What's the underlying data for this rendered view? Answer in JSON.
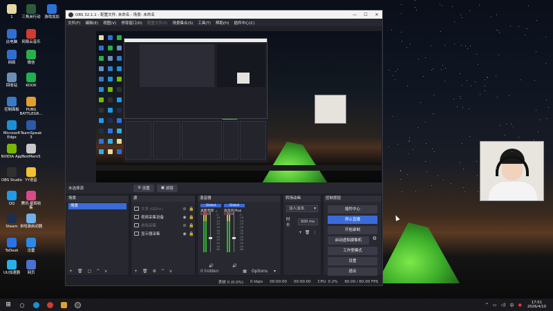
{
  "desktop": {
    "icons": [
      {
        "label": "1",
        "color": "#e8d9a0"
      },
      {
        "label": "三角洲行动",
        "color": "#2d5b3a"
      },
      {
        "label": "游戏加加",
        "color": "#2a72d8"
      },
      {
        "label": "此电脑",
        "color": "#2f6fd1"
      },
      {
        "label": "网易云音乐",
        "color": "#d33a31"
      },
      {
        "label": "网络",
        "color": "#2f6fd1"
      },
      {
        "label": "微信",
        "color": "#2aae4a"
      },
      {
        "label": "回收站",
        "color": "#6a8fb8"
      },
      {
        "label": "KOOK",
        "color": "#1fb14e"
      },
      {
        "label": "控制面板",
        "color": "#3a78c8"
      },
      {
        "label": "PUBG BATTLEGR...",
        "color": "#e0a030"
      },
      {
        "label": "Microsoft Edge",
        "color": "#1d8fd8"
      },
      {
        "label": "TeamSpeak 3",
        "color": "#2c5aa8"
      },
      {
        "label": "NVIDIA App",
        "color": "#76b900"
      },
      {
        "label": "TestMem5",
        "color": "#c8c8c8"
      },
      {
        "label": "OBS Studio",
        "color": "#303030"
      },
      {
        "label": "YY语音",
        "color": "#f2c230"
      },
      {
        "label": "QQ",
        "color": "#1e9ae8"
      },
      {
        "label": "腾讯·星辉收集",
        "color": "#d84a8a"
      },
      {
        "label": "Steam",
        "color": "#1c2f4f"
      },
      {
        "label": "米哈游启动器",
        "color": "#6fb0e8"
      },
      {
        "label": "ToDesk",
        "color": "#2a72e8"
      },
      {
        "label": "迅雷",
        "color": "#2a8ae8"
      },
      {
        "label": "UU加速器",
        "color": "#2ab0e8"
      },
      {
        "label": "网页",
        "color": "#4a70d0"
      }
    ]
  },
  "obs": {
    "title": "OBS 32.1.1 - 配置文件: 未命名 - 场景: 未命名",
    "menu": [
      "文件(F)",
      "编辑(E)",
      "视图(V)",
      "停靠窗口(D)",
      "配置文件(P)",
      "场景集合(S)",
      "工具(T)",
      "帮助(H)",
      "插件中心(C)"
    ],
    "menu_dim": [
      false,
      false,
      false,
      false,
      true,
      false,
      false,
      false,
      false
    ],
    "scene_bar": {
      "no_selection": "未选择源",
      "properties": "设置",
      "filters": "滤镜"
    },
    "scenes": {
      "header": "场景",
      "items": [
        "场景"
      ]
    },
    "sources": {
      "header": "源",
      "items": [
        {
          "label": "文本 (GDI+)",
          "dim": true
        },
        {
          "label": "视频采集设备",
          "dim": false
        },
        {
          "label": "游戏采集",
          "dim": true
        },
        {
          "label": "显示器采集",
          "dim": false
        }
      ]
    },
    "mixer": {
      "header": "混音器",
      "channels": [
        {
          "name": "桌面音频",
          "global": "Global",
          "db": "0.0 dB"
        },
        {
          "name": "麦克风/Aux",
          "global": "Global",
          "db": "0.0 dB"
        }
      ],
      "scale": [
        "0",
        "-5",
        "-10",
        "-15",
        "-20",
        "-25",
        "-30",
        "-35",
        "-40",
        "-45",
        "-50",
        "-55",
        "-60"
      ],
      "hidden": "0 hidden",
      "options": "Options"
    },
    "transitions": {
      "header": "转场动画",
      "selected": "淡入淡出",
      "duration_label": "时长",
      "duration": "300 ms"
    },
    "controls": {
      "header": "控制按钮",
      "buttons": [
        {
          "label": "插件中心",
          "active": false
        },
        {
          "label": "停止直播",
          "active": true
        },
        {
          "label": "开始录制",
          "active": false
        },
        {
          "label": "启动虚拟摄像机",
          "active": false
        },
        {
          "label": "工作室模式",
          "active": false
        },
        {
          "label": "设置",
          "active": false
        },
        {
          "label": "退出",
          "active": false
        }
      ]
    },
    "status": {
      "dropped": "丢帧 0 (0.0%)",
      "bitrate": "0 kbps",
      "stream_time": "00:00:00",
      "rec_time": "00:00:00",
      "cpu": "CPU: 0.2%",
      "fps": "60.00 / 60.00 FPS"
    }
  },
  "taskbar": {
    "time": "17:51",
    "date": "2026/4/10",
    "lang": "中"
  }
}
